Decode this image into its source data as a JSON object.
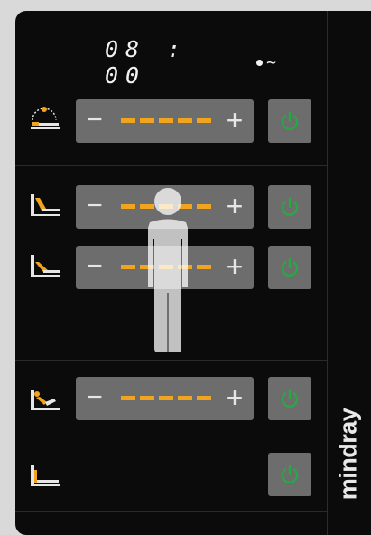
{
  "clock": {
    "time": "08 : 00",
    "indicator": "~"
  },
  "brand": {
    "name": "mindray"
  },
  "rows": [
    {
      "name": "head-section",
      "icon": "table-head-tilt-icon",
      "has_slider": true,
      "power_icon": "power-icon",
      "power_color": "#27a844"
    },
    {
      "name": "back-section",
      "icon": "table-back-up-icon",
      "has_slider": true,
      "power_icon": "power-icon",
      "power_color": "#27a844"
    },
    {
      "name": "seat-section",
      "icon": "table-seat-tilt-icon",
      "has_slider": true,
      "power_icon": "power-icon",
      "power_color": "#27a844"
    },
    {
      "name": "leg-section",
      "icon": "table-leg-icon",
      "has_slider": true,
      "power_icon": "power-icon",
      "power_color": "#27a844"
    },
    {
      "name": "height-section",
      "icon": "table-height-icon",
      "has_slider": false,
      "power_icon": "power-icon",
      "power_color": "#27a844"
    }
  ],
  "colors": {
    "segment": "#f0a41f",
    "panel": "#0c0b0b",
    "button": "#6d6d6d",
    "power": "#27a844",
    "icon_accent": "#f0a41f"
  }
}
